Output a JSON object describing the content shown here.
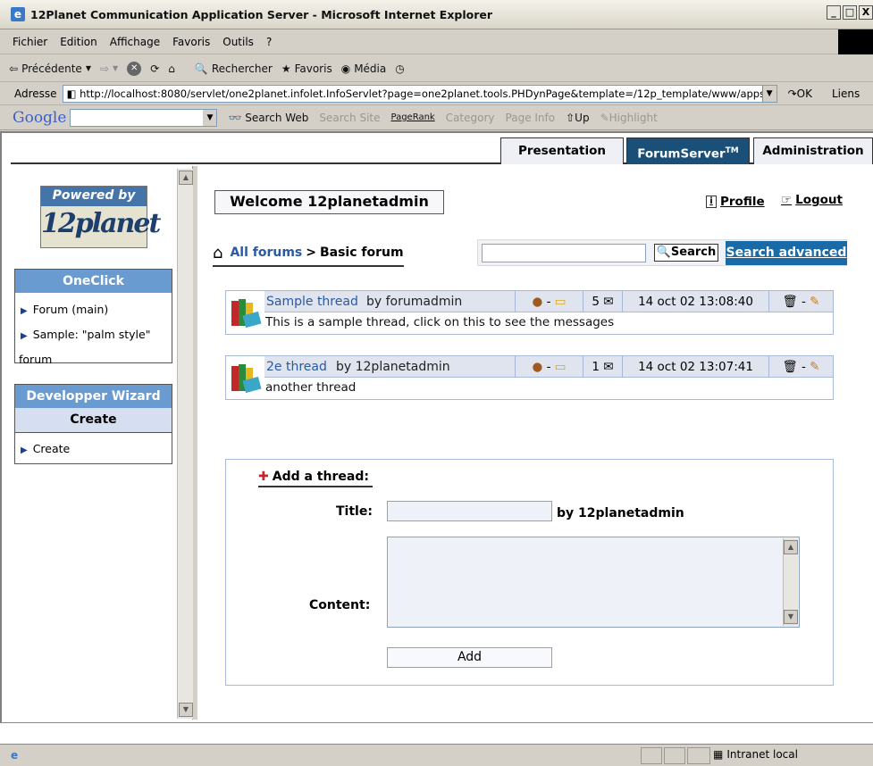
{
  "window": {
    "title": "12Planet Communication Application Server - Microsoft Internet Explorer",
    "buttons": [
      "_",
      "□",
      "X"
    ]
  },
  "menu": [
    "Fichier",
    "Edition",
    "Affichage",
    "Favoris",
    "Outils",
    "?"
  ],
  "toolbar": {
    "back": "Précédente",
    "search": "Rechercher",
    "favorites": "Favoris",
    "media": "Média"
  },
  "address": {
    "label": "Adresse",
    "url": "http://localhost:8080/servlet/one2planet.infolet.InfoServlet?page=one2planet.tools.PHDynPage&template=/12p_template/www/apps/fo",
    "go": "OK",
    "links": "Liens"
  },
  "googlebar": {
    "logo": "Google",
    "search_web": "Search Web",
    "search_site": "Search Site",
    "pagerank": "PageRank",
    "category": "Category",
    "page_info": "Page Info",
    "up": "Up",
    "highlight": "Highlight"
  },
  "tabs": {
    "presentation": "Presentation",
    "forumserver": "ForumServer",
    "forumserver_tm": "TM",
    "administration": "Administration"
  },
  "logo": {
    "powered": "Powered by",
    "name": "12planet"
  },
  "oneclick": {
    "title": "OneClick",
    "items": [
      "Forum (main)",
      "Sample: \"palm style\"",
      "forum"
    ]
  },
  "wizard": {
    "title": "Developper Wizard",
    "subtitle": "Create",
    "items": [
      "Create"
    ]
  },
  "welcome": "Welcome 12planetadmin",
  "profile": "Profile",
  "logout": "Logout",
  "breadcrumb": {
    "all": "All forums",
    "sep": ">",
    "current": "Basic forum"
  },
  "search": {
    "button": "Search",
    "advanced": "Search advanced",
    "value": ""
  },
  "threads": [
    {
      "title": "Sample thread",
      "by": "by forumadmin",
      "dash1": "-",
      "count": "5",
      "date": "14 oct 02 13:08:40",
      "dash2": "-",
      "desc": "This is a sample thread, click on this to see the messages"
    },
    {
      "title": "2e thread",
      "by": "by 12planetadmin",
      "dash1": "-",
      "count": "1",
      "date": "14 oct 02 13:07:41",
      "dash2": "-",
      "desc": "another thread"
    }
  ],
  "addthread": {
    "plus": "✚",
    "title": "Add a thread:",
    "title_label": "Title:",
    "title_value": "",
    "by": "by 12planetadmin",
    "content_label": "Content:",
    "content_value": "",
    "add": "Add"
  },
  "status": {
    "zone": "Intranet local"
  }
}
